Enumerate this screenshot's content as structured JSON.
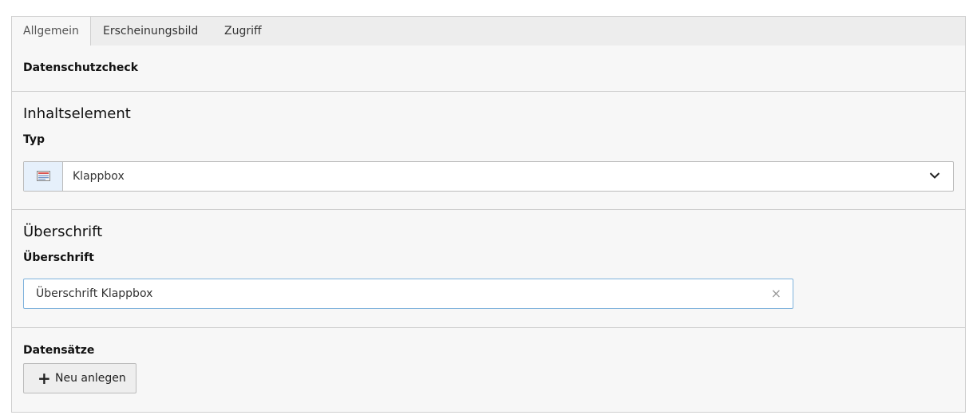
{
  "tabs": [
    {
      "label": "Allgemein",
      "active": true
    },
    {
      "label": "Erscheinungsbild",
      "active": false
    },
    {
      "label": "Zugriff",
      "active": false
    }
  ],
  "privacy": {
    "label": "Datenschutzcheck"
  },
  "content_element": {
    "title": "Inhaltselement",
    "type_label": "Typ",
    "type_value": "Klappbox",
    "type_icon": "content-element-icon"
  },
  "header_section": {
    "title": "Überschrift",
    "field_label": "Überschrift",
    "field_value": "Überschrift Klappbox",
    "clear_symbol": "×"
  },
  "records": {
    "label": "Datensätze",
    "new_button_symbol": "+",
    "new_button_label": "Neu anlegen"
  },
  "colors": {
    "accent_border": "#7fb2dc",
    "panel_bg": "#f7f7f7",
    "tab_bg": "#ededed"
  }
}
